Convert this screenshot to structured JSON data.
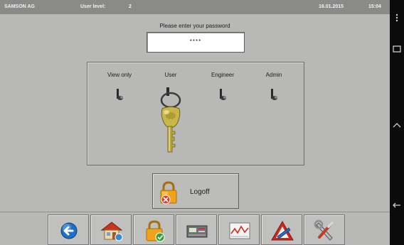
{
  "statusbar": {
    "company": "SAMSON AG",
    "user_level_label": "User level:",
    "user_level_value": "2",
    "date": "16.01.2015",
    "time": "15:04"
  },
  "login": {
    "prompt": "Please enter your password",
    "password_mask": "****"
  },
  "access_levels": {
    "labels": [
      "View only",
      "User",
      "Engineer",
      "Admin"
    ],
    "active": "User"
  },
  "logoff": {
    "label": "Logoff"
  },
  "toolbar": {
    "buttons": [
      "back-icon",
      "home-icon",
      "login-lock-icon",
      "device-icon",
      "trend-icon",
      "alarm-icon",
      "tools-icon"
    ]
  },
  "colors": {
    "background": "#b8b8b6",
    "statusbar": "#8a8a89",
    "key_gold": "#c9b64a",
    "lock_orange": "#f0a21a",
    "home_red": "#c8351f",
    "back_blue": "#1f6fc2"
  }
}
